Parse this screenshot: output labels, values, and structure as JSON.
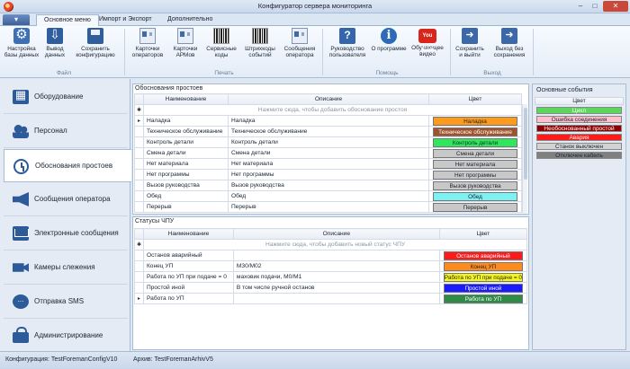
{
  "window": {
    "title": "Конфигуратор сервера мониторинга"
  },
  "tabs": [
    "Основное меню",
    "Импорт и Экспорт",
    "Дополнительно"
  ],
  "ribbon": {
    "buttons": [
      {
        "label": "Настройка\nбазы данных",
        "icon": "database-settings-icon"
      },
      {
        "label": "Вывод\nданных",
        "icon": "data-output-icon"
      },
      {
        "label": "Сохранить\nконфигурацию",
        "icon": "save-config-icon"
      },
      {
        "label": "Карточки\nоператоров",
        "icon": "operator-cards-icon"
      },
      {
        "label": "Карточки\nАРМов",
        "icon": "arm-cards-icon"
      },
      {
        "label": "Сервисные\nкоды",
        "icon": "service-codes-icon"
      },
      {
        "label": "Штрихкоды\nсобытий",
        "icon": "barcode-icon"
      },
      {
        "label": "Сообщения\nоператора",
        "icon": "operator-messages-icon"
      },
      {
        "label": "Руководство\nпользователя",
        "icon": "user-manual-icon"
      },
      {
        "label": "О программе",
        "icon": "info-icon"
      },
      {
        "label": "Обучающее\nвидео",
        "icon": "youtube-icon"
      },
      {
        "label": "Сохранить\nи выйти",
        "icon": "save-exit-icon"
      },
      {
        "label": "Выход без\nсохранения",
        "icon": "exit-icon"
      }
    ],
    "groups": [
      "Файл",
      "Печать",
      "Помощь",
      "Выход"
    ],
    "youtube_text": "You Tube"
  },
  "sidebar": [
    {
      "label": "Оборудование",
      "icon": "equipment-icon"
    },
    {
      "label": "Персонал",
      "icon": "personnel-icon"
    },
    {
      "label": "Обоснования простоев",
      "icon": "clock-icon"
    },
    {
      "label": "Сообщения оператора",
      "icon": "megaphone-icon"
    },
    {
      "label": "Электронные сообщения",
      "icon": "email-icon"
    },
    {
      "label": "Камеры слежения",
      "icon": "camera-icon"
    },
    {
      "label": "Отправка SMS",
      "icon": "sms-icon"
    },
    {
      "label": "Администрирование",
      "icon": "lock-icon"
    }
  ],
  "downtime": {
    "title": "Обоснования простоев",
    "columns": [
      "Наименование",
      "Описание",
      "Цвет"
    ],
    "hint": "Нажмите сюда, чтобы добавить обоснование простоя",
    "rows": [
      {
        "name": "Наладка",
        "desc": "Наладка",
        "color": "Наладка",
        "bg": "#ff9a1a",
        "current": true
      },
      {
        "name": "Техническое обслуживание",
        "desc": "Техническое обслуживание",
        "color": "Техническое обслуживание",
        "bg": "#a0522d"
      },
      {
        "name": "Контроль детали",
        "desc": "Контроль детали",
        "color": "Контроль детали",
        "bg": "#2ee85a"
      },
      {
        "name": "Смена детали",
        "desc": "Смена детали",
        "color": "Смена детали",
        "bg": "#c8c8c8"
      },
      {
        "name": "Нет материала",
        "desc": "Нет материала",
        "color": "Нет материала",
        "bg": "#c8c8c8"
      },
      {
        "name": "Нет программы",
        "desc": "Нет программы",
        "color": "Нет программы",
        "bg": "#c8c8c8"
      },
      {
        "name": "Вызов руководства",
        "desc": "Вызов руководства",
        "color": "Вызов руководства",
        "bg": "#c8c8c8"
      },
      {
        "name": "Обед",
        "desc": "Обед",
        "color": "Обед",
        "bg": "#7df2f2"
      },
      {
        "name": "Перерыв",
        "desc": "Перерыв",
        "color": "Перерыв",
        "bg": "#c8c8c8"
      }
    ]
  },
  "cnc": {
    "title": "Статусы ЧПУ",
    "columns": [
      "Наименование",
      "Описание",
      "Цвет"
    ],
    "hint": "Нажмите сюда, чтобы добавить новый статус ЧПУ",
    "rows": [
      {
        "name": "Останов аварийный",
        "desc": "",
        "color": "Останов аварийный",
        "bg": "#ff1a1a"
      },
      {
        "name": "Конец УП",
        "desc": "М30/М02",
        "color": "Конец УП",
        "bg": "#ff8c1a"
      },
      {
        "name": "Работа по УП при подаче = 0",
        "desc": "маховик подачи, М0/М1",
        "color": "Работа по УП при подаче = 0",
        "bg": "#f5f51a"
      },
      {
        "name": "Простой иной",
        "desc": "В том числе ручной останов",
        "color": "Простой иной",
        "bg": "#1a1aff"
      },
      {
        "name": "Работа по УП",
        "desc": "",
        "color": "Работа по УП",
        "bg": "#2e8b46",
        "current": true
      }
    ]
  },
  "events": {
    "title": "Основные события",
    "header": "Цвет",
    "items": [
      {
        "label": "Цикл",
        "bg": "#5cd65c",
        "fg": "#ffffff"
      },
      {
        "label": "Ошибка соединения",
        "bg": "#ffc0cb",
        "fg": "#1b2533"
      },
      {
        "label": "Необоснованный простой",
        "bg": "#8b0000",
        "fg": "#ffffff"
      },
      {
        "label": "Авария",
        "bg": "#ff1a1a",
        "fg": "#ffffff"
      },
      {
        "label": "Станок выключен",
        "bg": "#d3d3d3",
        "fg": "#1b2533"
      },
      {
        "label": "Отключен кабель",
        "bg": "#808080",
        "fg": "#1b2533"
      }
    ]
  },
  "status": {
    "config": "Конфигурация: TestForemanConfigV10",
    "archive": "Архив: TestForemanArhivV5"
  }
}
